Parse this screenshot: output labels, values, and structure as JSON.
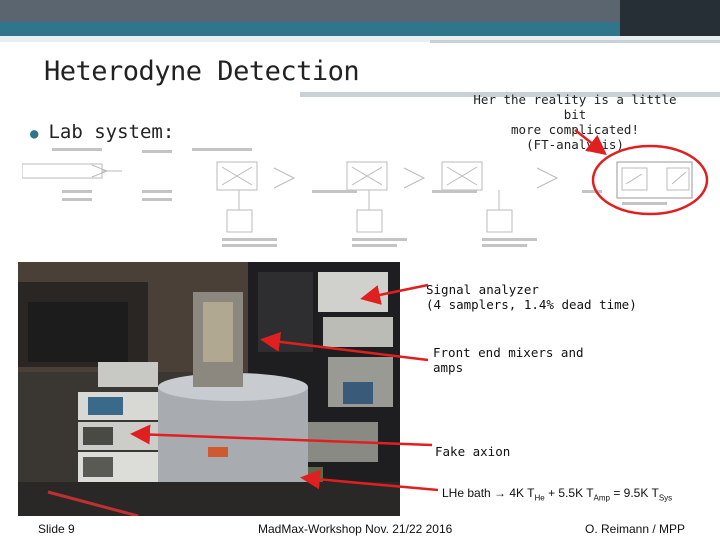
{
  "slide": {
    "title": "Heterodyne Detection",
    "bullet": "Lab system:",
    "note_lines": [
      "Her the reality is a little bit",
      "more complicated!",
      "(FT-analysis)"
    ],
    "callouts": {
      "signal_analyzer_line1": "Signal analyzer",
      "signal_analyzer_line2": "(4 samplers, 1.4% dead time)",
      "front_end_line1": "Front end mixers and",
      "front_end_line2": "amps",
      "fake_axion": "Fake axion",
      "lhe_prefix": "LHe bath → 4K T",
      "lhe_sub1": "He",
      "lhe_mid": " + 5.5K T",
      "lhe_sub2": "Amp",
      "lhe_mid2": " = 9.5K T",
      "lhe_sub3": "Sys"
    },
    "footer": {
      "left": "Slide 9",
      "center": "MadMax-Workshop Nov. 21/22 2016",
      "right": "O. Reimann / MPP"
    }
  },
  "colors": {
    "accent": "#30768a",
    "arrow": "#e02020",
    "header": "#5a6570"
  },
  "icons": [
    "bullet-dot-icon"
  ]
}
